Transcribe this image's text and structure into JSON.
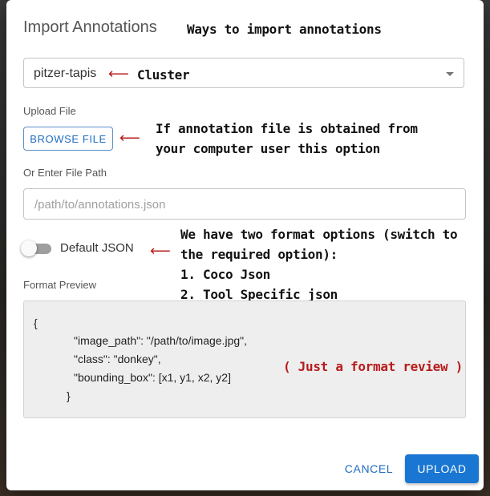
{
  "dialog": {
    "title": "Import Annotations",
    "title_annotation": "Ways to import annotations"
  },
  "cluster": {
    "selected": "pitzer-tapis",
    "annotation": "Cluster"
  },
  "upload": {
    "label": "Upload File",
    "browse_label": "BROWSE FILE",
    "annotation_line1": "If annotation file is obtained from",
    "annotation_line2": "your computer user this option"
  },
  "path": {
    "label": "Or Enter File Path",
    "placeholder": "/path/to/annotations.json"
  },
  "format": {
    "toggle_label": "Default JSON",
    "toggle_on": false,
    "annotation_line1": "We have two format options (switch to",
    "annotation_line2": "the required option):",
    "annotation_line3": "1. Coco Json",
    "annotation_line4": "2. Tool Specific json"
  },
  "preview": {
    "label": "Format Preview",
    "lines": [
      "{",
      "\"image_path\": \"/path/to/image.jpg\",",
      "\"class\": \"donkey\",",
      "\"bounding_box\": [x1, y1, x2, y2]",
      "}"
    ],
    "annotation": "( Just a format review )"
  },
  "footer": {
    "cancel_label": "CANCEL",
    "upload_label": "UPLOAD"
  },
  "colors": {
    "accent": "#1976d2",
    "annotation_arrow": "#b71c1c"
  }
}
